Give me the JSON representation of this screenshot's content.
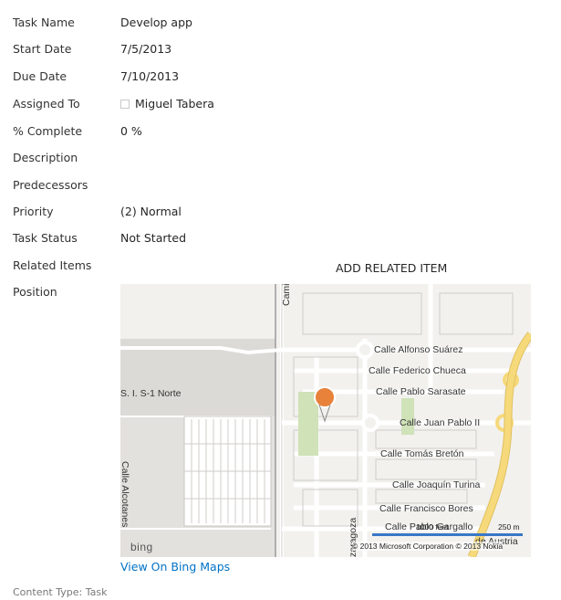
{
  "fields": [
    {
      "label": "Task Name",
      "value": "Develop app"
    },
    {
      "label": "Start Date",
      "value": "7/5/2013"
    },
    {
      "label": "Due Date",
      "value": "7/10/2013"
    },
    {
      "label": "Assigned To",
      "value": "Miguel Tabera"
    },
    {
      "label": "% Complete",
      "value": "0 %"
    },
    {
      "label": "Description",
      "value": ""
    },
    {
      "label": "Predecessors",
      "value": ""
    },
    {
      "label": "Priority",
      "value": "(2) Normal"
    },
    {
      "label": "Task Status",
      "value": "Not Started"
    },
    {
      "label": "Related Items",
      "value": ""
    },
    {
      "label": "Position",
      "value": ""
    }
  ],
  "related_items": {
    "add_label": "ADD RELATED ITEM"
  },
  "map": {
    "streets": {
      "camino": "Cami",
      "alfonso": "Calle Alfonso Suárez",
      "federico": "Calle Federico Chueca",
      "pablo": "Calle Pablo Sarasate",
      "juan": "Calle Juan Pablo II",
      "tomas": "Calle Tomás Bretón",
      "joaquin": "Calle Joaquín Turina",
      "francisco": "Calle Francisco Bores",
      "pablo_gargallo": "Calle Pablo Gargallo",
      "alcotanes": "Calle Alcotanes",
      "zaragoza": "zaragoza",
      "sis": "S. I. S-1 Norte",
      "austria": "de Austria"
    },
    "logo": "bing",
    "copyright": "© 2013 Microsoft Corporation   © 2013 Nokia",
    "scale_ft": "1000 feet",
    "scale_m": "250 m",
    "pin_color": "#e8823a",
    "highway_color": "#f6d97a"
  },
  "links": {
    "view_on_bing": "View On Bing Maps"
  },
  "footer": {
    "content_type": "Content Type: Task"
  }
}
